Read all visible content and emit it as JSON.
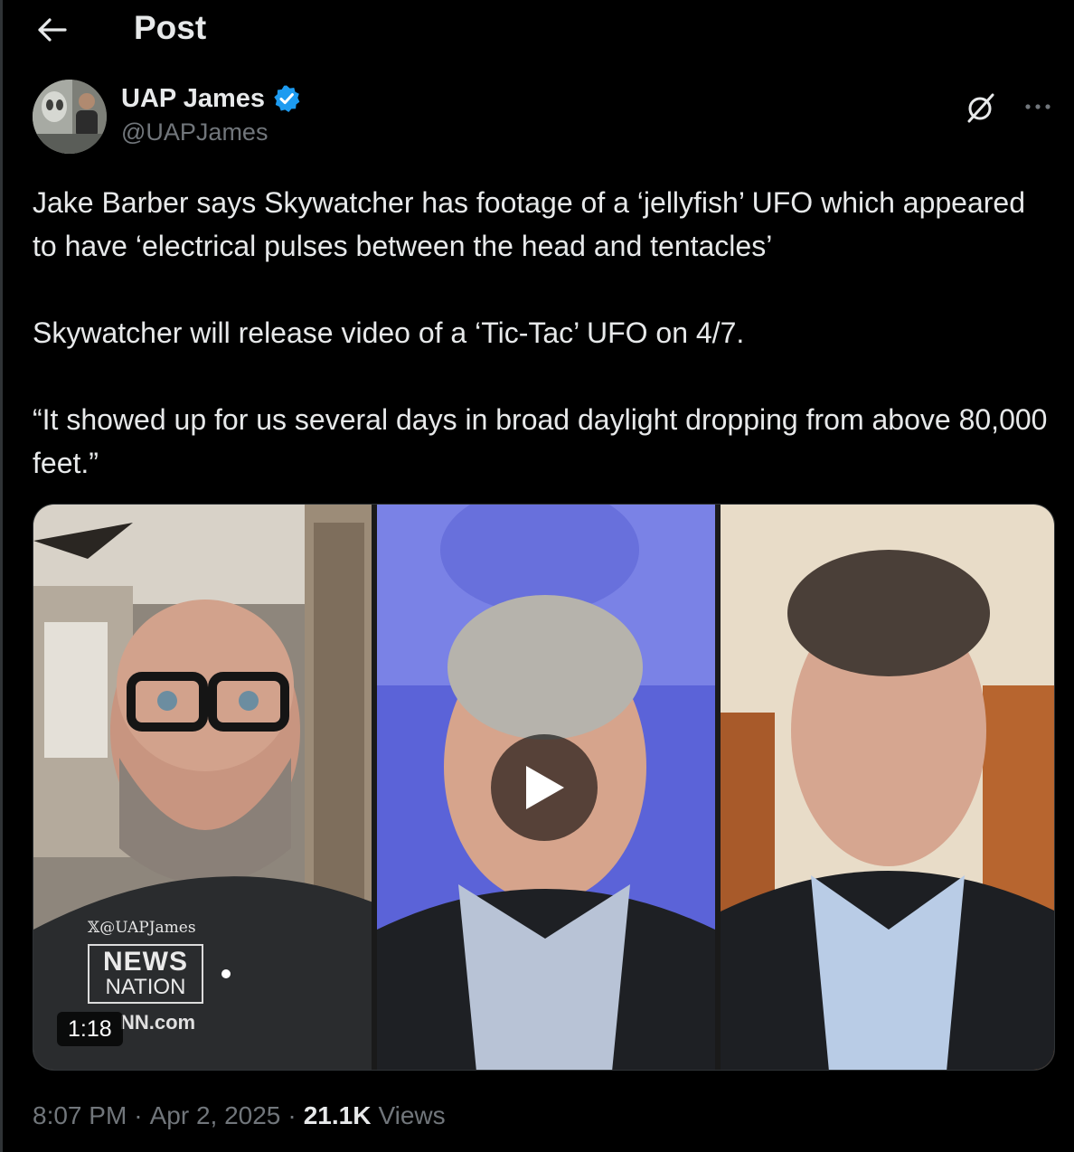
{
  "header": {
    "title": "Post",
    "back_icon": "arrow-left-icon"
  },
  "author": {
    "display_name": "UAP James",
    "handle": "@UAPJames",
    "verified": true,
    "verified_color": "#1d9bf0"
  },
  "tweet": {
    "paragraphs": [
      "Jake Barber says Skywatcher has footage of a ‘jellyfish’ UFO which appeared to have ‘electrical pulses between the head and tentacles’",
      "Skywatcher will release video of a ‘Tic-Tac’ UFO on 4/7.",
      "“It showed up for us several days in broad daylight dropping from above 80,000 feet.”"
    ]
  },
  "media": {
    "type": "video",
    "duration": "1:18",
    "watermark": "𝕏@UAPJames",
    "logo_line1": "NEWS",
    "logo_line2": "NATION",
    "site_text": "NN.com"
  },
  "meta": {
    "time": "8:07 PM",
    "separator": "·",
    "date": "Apr 2, 2025",
    "views_count": "21.1K",
    "views_label": "Views"
  },
  "colors": {
    "background": "#000000",
    "text_primary": "#e7e9ea",
    "text_secondary": "#71767b",
    "border": "#2f3336"
  }
}
